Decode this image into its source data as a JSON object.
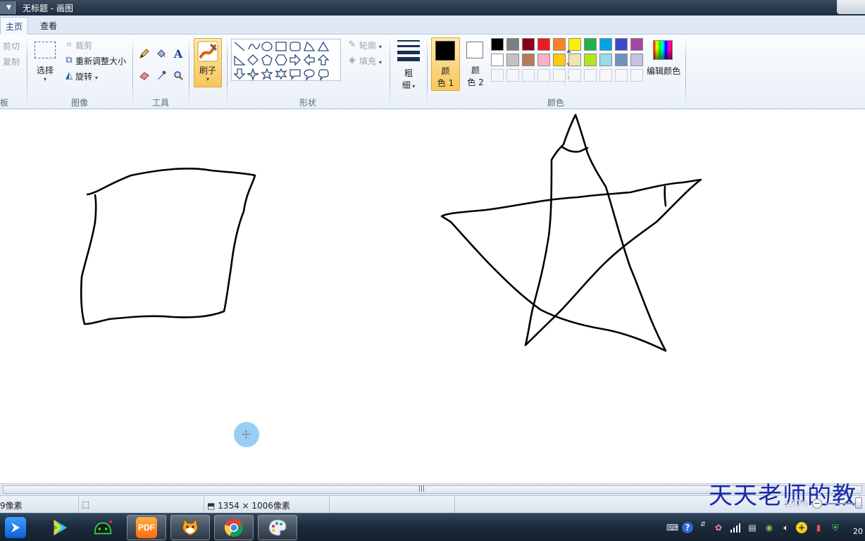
{
  "window": {
    "title": "无标题 - 画图"
  },
  "tabs": [
    {
      "label": "主页",
      "active": true
    },
    {
      "label": "查看",
      "active": false
    }
  ],
  "clipboard": {
    "cut_label": "剪切",
    "copy_label": "复制",
    "group_label_partial": "板"
  },
  "image": {
    "select_label": "选择",
    "crop_label": "裁剪",
    "resize_label": "重新调整大小",
    "rotate_label": "旋转",
    "group_label": "图像"
  },
  "tools": {
    "group_label": "工具",
    "text_tool_glyph": "A"
  },
  "brush": {
    "label": "刷子"
  },
  "shapes": {
    "outline_label": "轮廓",
    "fill_label": "填充",
    "group_label": "形状"
  },
  "size": {
    "label_line1": "粗",
    "label_line2": "细"
  },
  "colors": {
    "color1_line1": "颜",
    "color1_line2": "色 1",
    "color2_line1": "颜",
    "color2_line2": "色 2",
    "color1_value": "#000000",
    "color2_value": "#ffffff",
    "edit_label": "编辑颜色",
    "group_label": "颜色",
    "palette_row1": [
      "#000000",
      "#7f7f7f",
      "#880015",
      "#ed1c24",
      "#ff7f27",
      "#fff200",
      "#22b14c",
      "#00a2e8",
      "#3f48cc",
      "#a349a4"
    ],
    "palette_row2": [
      "#ffffff",
      "#c3c3c3",
      "#b97a57",
      "#ffaec9",
      "#ffc90e",
      "#efe4b0",
      "#b5e61d",
      "#99d9ea",
      "#7092be",
      "#c8bfe7"
    ]
  },
  "status": {
    "cursor_pos_partial": "9像素",
    "canvas_size": "1354 × 1006像素",
    "zoom": "100%",
    "minus": "−"
  },
  "watermark": "天天老师的教",
  "taskbar": {
    "pdf_label": "PDF",
    "clock_partial": "20"
  },
  "accent": "#f8c65c"
}
